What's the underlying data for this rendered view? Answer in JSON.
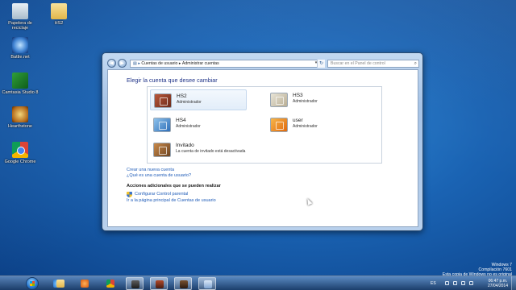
{
  "desktop": {
    "icons": [
      {
        "label": "Papelera de reciclaje",
        "icon": "recycle-bin-icon"
      },
      {
        "label": "HS2",
        "icon": "folder-icon"
      },
      {
        "label": "Battle.net",
        "icon": "battlenet-icon"
      },
      {
        "label": "Camtasia Studio 8",
        "icon": "camtasia-icon"
      },
      {
        "label": "Hearthstone",
        "icon": "hearthstone-icon"
      },
      {
        "label": "Google Chrome",
        "icon": "chrome-icon"
      }
    ]
  },
  "window": {
    "breadcrumb": [
      "Cuentas de usuario",
      "Administrar cuentas"
    ],
    "search_placeholder": "Buscar en el Panel de control",
    "heading": "Elegir la cuenta que desee cambiar",
    "accounts": [
      {
        "name": "HS2",
        "role": "Administrador",
        "selected": true
      },
      {
        "name": "HS3",
        "role": "Administrador"
      },
      {
        "name": "HS4",
        "role": "Administrador"
      },
      {
        "name": "user",
        "role": "Administrador"
      },
      {
        "name": "Invitado",
        "role": "La cuenta de invitado está desactivada"
      }
    ],
    "links": {
      "create_account": "Crear una nueva cuenta",
      "what_is_account": "¿Qué es una cuenta de usuario?"
    },
    "additional": {
      "title": "Acciones adicionales que se pueden realizar",
      "parental": "Configurar Control parental",
      "main_page": "Ir a la página principal de Cuentas de usuario"
    }
  },
  "watermark": {
    "line1": "Windows 7",
    "line2": "Compilación 7601",
    "line3": "Esta copia de Windows no es original"
  },
  "taskbar": {
    "language": "ES",
    "time": "06:47 p.m.",
    "date": "27/04/2014",
    "buttons": [
      "ie-icon",
      "explorer-icon",
      "media-player-icon",
      "chrome-icon",
      "app-icon",
      "app-icon",
      "app-icon",
      "control-panel-icon"
    ]
  },
  "colors": {
    "link": "#1f5cb8",
    "heading": "#1e3287",
    "desktop": "#1a63b3"
  }
}
